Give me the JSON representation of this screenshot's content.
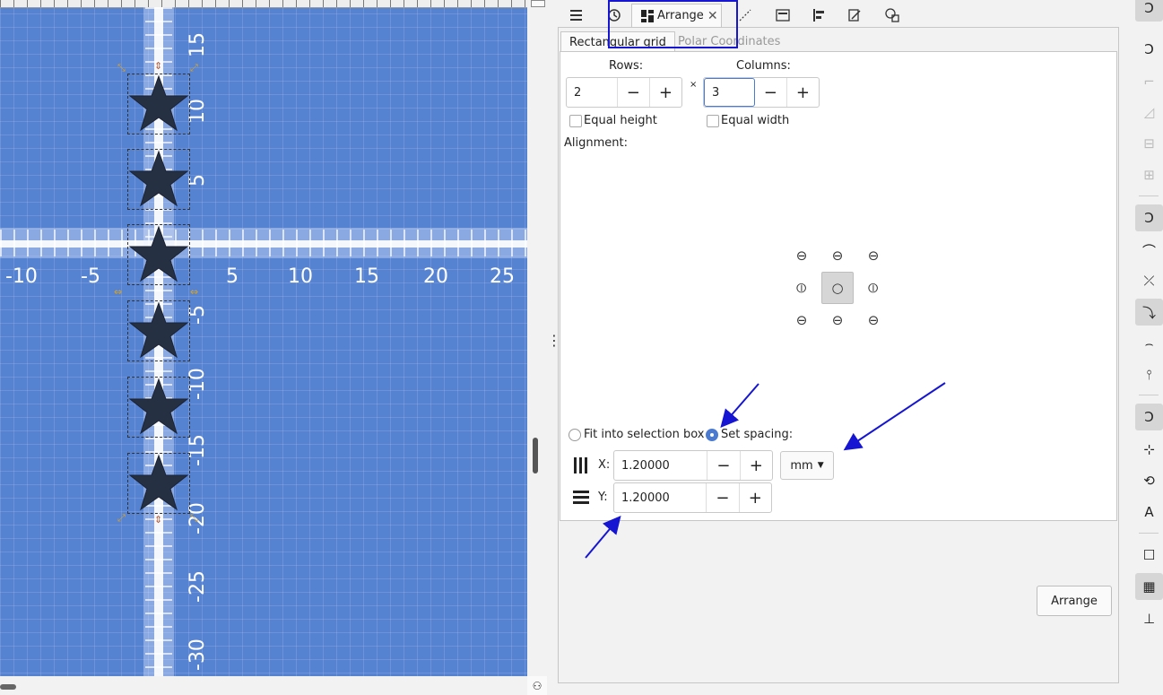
{
  "canvas": {
    "x_ruler_labels": [
      "-10",
      "-5",
      "5",
      "10",
      "15",
      "20",
      "25"
    ],
    "y_ruler_labels": [
      "15",
      "10",
      "5",
      "-5",
      "-10",
      "-15",
      "-20",
      "-25",
      "-30"
    ],
    "star_count": 6,
    "background_color": "#5682d2"
  },
  "panel": {
    "tab_icons": [
      "objects-icon",
      "history-icon",
      "arrange-icon",
      "snap-icon",
      "document-properties-icon",
      "align-icon",
      "fill-stroke-icon",
      "shapes-icon"
    ],
    "active_tab_label": "Arrange",
    "subtabs": {
      "rectangular": "Rectangular grid",
      "polar": "Polar Coordinates"
    },
    "rows_label": "Rows:",
    "columns_label": "Columns:",
    "rows_value": "2",
    "columns_value": "3",
    "times_sign": "×",
    "equal_height_label": "Equal height",
    "equal_width_label": "Equal width",
    "alignment_label": "Alignment:",
    "fit_label": "Fit into selection box",
    "set_spacing_label": "Set spacing:",
    "x_label": "X:",
    "y_label": "Y:",
    "x_value": "1.20000",
    "y_value": "1.20000",
    "units_value": "mm",
    "minus": "−",
    "plus": "+",
    "arrange_button": "Arrange",
    "accent_color": "#4a7bd0",
    "highlight_color": "#1515d2"
  }
}
